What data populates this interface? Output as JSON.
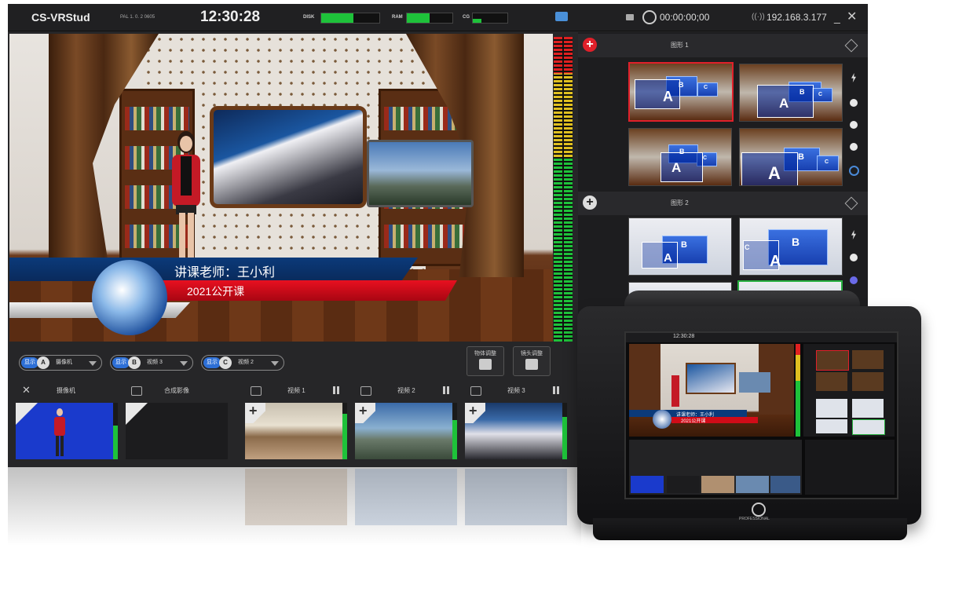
{
  "app": {
    "name": "CS-VRStud",
    "format": "PAL 1. 0. 2 0605",
    "clock": "12:30:28",
    "disk_label": "DISK",
    "disk_level": 0.55,
    "ram_label": "RAM",
    "ram_level": 0.5,
    "cg_label": "CG",
    "cg_level": 0.25,
    "record_time": "00:00:00;00",
    "ip": "192.168.3.177"
  },
  "preview": {
    "lower_third_name": "讲课老师：王小利",
    "lower_third_title": "2021公开课"
  },
  "graphics": {
    "group1_title": "图形 1",
    "group2_title": "图形 2",
    "label_a": "A",
    "label_b": "B",
    "label_c": "C"
  },
  "sources": {
    "slots": [
      {
        "show": "显示",
        "letter": "A",
        "name": "摄像机"
      },
      {
        "show": "显示",
        "letter": "B",
        "name": "视频 3"
      },
      {
        "show": "显示",
        "letter": "C",
        "name": "视频 2"
      }
    ],
    "object_adjust": "物体调整",
    "camera_adjust": "镜头调整",
    "headers": [
      "摄像机",
      "合成影像",
      "视频 1",
      "视频 2",
      "视频 3"
    ],
    "levels": [
      0.6,
      0.0,
      0.8,
      0.7,
      0.75
    ]
  },
  "device": {
    "brand": "PROFESSIONAL",
    "clock": "12:30:28",
    "name_line": "讲课老师：王小利",
    "title_line": "2021公开课"
  },
  "colors": {
    "accent_red": "#e0202a",
    "meter_green": "#1ec23a",
    "show_blue": "#2d6fd6"
  }
}
